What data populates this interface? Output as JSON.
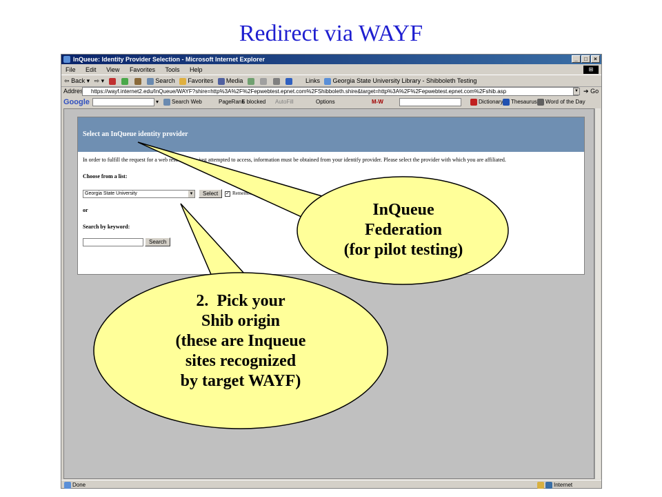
{
  "slide_title": "Redirect via WAYF",
  "window": {
    "title": "InQueue: Identity Provider Selection - Microsoft Internet Explorer",
    "controls": [
      "_",
      "□",
      "×"
    ]
  },
  "menu": [
    "File",
    "Edit",
    "View",
    "Favorites",
    "Tools",
    "Help"
  ],
  "toolbar": {
    "back": "Back",
    "search": "Search",
    "favorites": "Favorites",
    "media": "Media",
    "links": "Links",
    "link_item": "Georgia State University Library - Shibboleth Testing"
  },
  "address": {
    "label": "Address",
    "url": "https://wayf.internet2.edu/InQueue/WAYF?shire=http%3A%2F%2Fepwebtest.epnet.com%2FShibboleth.shire&target=http%3A%2F%2Fepwebtest.epnet.com%2Fshib.asp",
    "go": "Go"
  },
  "google_bar": {
    "logo": "Google",
    "search_web": "Search Web",
    "pagerank": "PageRank",
    "blocked": "5 blocked",
    "autofill": "AutoFill",
    "options": "Options",
    "dictionary": "Dictionary",
    "thesaurus": "Thesaurus",
    "word_of_day": "Word of the Day"
  },
  "wayf": {
    "header": "Select an InQueue identity provider",
    "intro": "In order to fulfill the request for a web resource you just attempted to access, information must be obtained from your identify provider. Please select the provider with which you are affiliated.",
    "choose_label": "Choose from a list:",
    "selected_provider": "Georgia State University",
    "select_button": "Select",
    "remember_label": "Remember my selection",
    "or_label": "or",
    "keyword_label": "Search by keyword:",
    "search_value": "",
    "search_button": "Search"
  },
  "status": {
    "left": "Done",
    "zone": "Internet"
  },
  "callouts": {
    "federation": [
      "InQueue",
      "Federation",
      "(for pilot testing)"
    ],
    "pick": [
      "2.  Pick your",
      "Shib origin",
      "(these are Inqueue",
      "sites recognized",
      "by target WAYF)"
    ]
  },
  "colors": {
    "title_blue": "#1f1fd0",
    "callout_fill": "#ffff99",
    "wayf_header": "#6f8fb2"
  }
}
